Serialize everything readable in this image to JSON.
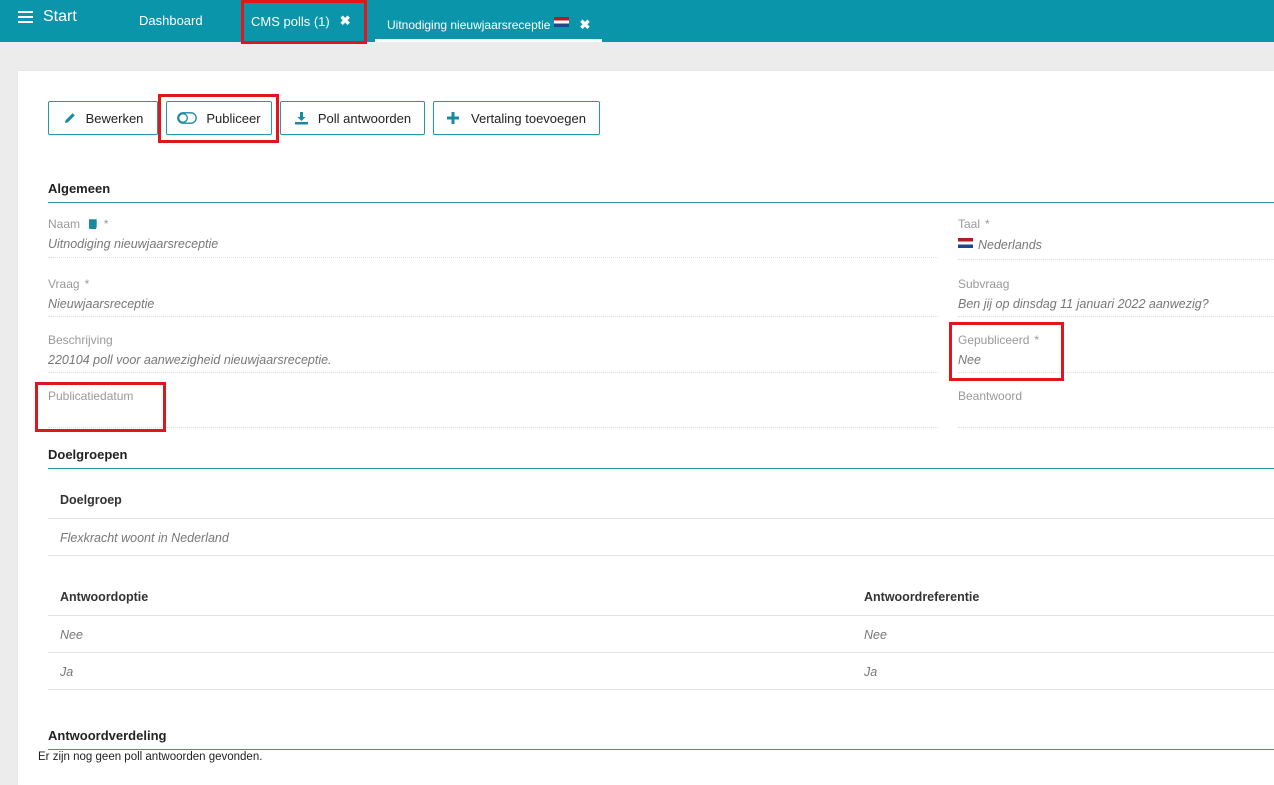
{
  "topbar": {
    "start_label": "Start",
    "tabs": [
      {
        "label": "Dashboard"
      },
      {
        "label": "CMS polls (1)",
        "close": "✖"
      },
      {
        "label": "Uitnodiging nieuwjaarsreceptie",
        "close": "✖",
        "flag": "nl-flag-icon"
      }
    ]
  },
  "toolbar": {
    "buttons": [
      {
        "label": "Bewerken",
        "icon": "pencil-icon"
      },
      {
        "label": "Publiceer",
        "icon": "toggle-icon"
      },
      {
        "label": "Poll antwoorden",
        "icon": "download-icon"
      },
      {
        "label": "Vertaling toevoegen",
        "icon": "plus-icon"
      }
    ]
  },
  "algemeen": {
    "title": "Algemeen",
    "naam_label": "Naam",
    "naam_value": "Uitnodiging nieuwjaarsreceptie",
    "taal_label": "Taal",
    "taal_value": "Nederlands",
    "vraag_label": "Vraag",
    "vraag_value": "Nieuwjaarsreceptie",
    "subvraag_label": "Subvraag",
    "subvraag_value": "Ben jij op dinsdag 11 januari 2022 aanwezig?",
    "beschrijving_label": "Beschrijving",
    "beschrijving_value": "220104 poll voor aanwezigheid nieuwjaarsreceptie.",
    "gepubliceerd_label": "Gepubliceerd",
    "gepubliceerd_value": "Nee",
    "publicatiedatum_label": "Publicatiedatum",
    "beantwoord_label": "Beantwoord",
    "required_mark": "*"
  },
  "doelgroepen": {
    "title": "Doelgroepen",
    "header": "Doelgroep",
    "rows": [
      "Flexkracht woont in Nederland"
    ]
  },
  "antwoorden": {
    "col1_header": "Antwoordoptie",
    "col2_header": "Antwoordreferentie",
    "rows": [
      {
        "optie": "Nee",
        "referentie": "Nee"
      },
      {
        "optie": "Ja",
        "referentie": "Ja"
      }
    ]
  },
  "verdeling": {
    "title": "Antwoordverdeling",
    "empty_message": "Er zijn nog geen poll antwoorden gevonden."
  },
  "colors": {
    "topbar": "#0b95aa",
    "accent": "#2a95aa",
    "highlight": "#e0161d"
  }
}
